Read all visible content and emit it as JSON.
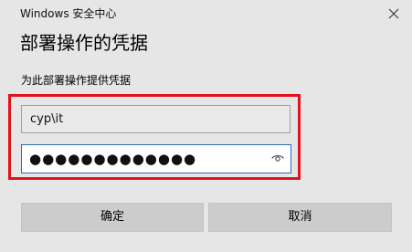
{
  "window": {
    "title": "Windows 安全中心"
  },
  "dialog": {
    "heading": "部署操作的凭据",
    "instruction": "为此部署操作提供凭据"
  },
  "username_field": {
    "value": "cyp\\it"
  },
  "password_field": {
    "masked_value": "●●●●●●●●●●●●●"
  },
  "buttons": {
    "ok_label": "确定",
    "cancel_label": "取消"
  },
  "icons": {
    "close": "close-icon",
    "reveal_password": "eye-icon"
  },
  "colors": {
    "background": "#e6e6e6",
    "highlight_border": "#e0121c",
    "focused_input_border": "#2c6db4",
    "button_background": "#cccccc"
  }
}
